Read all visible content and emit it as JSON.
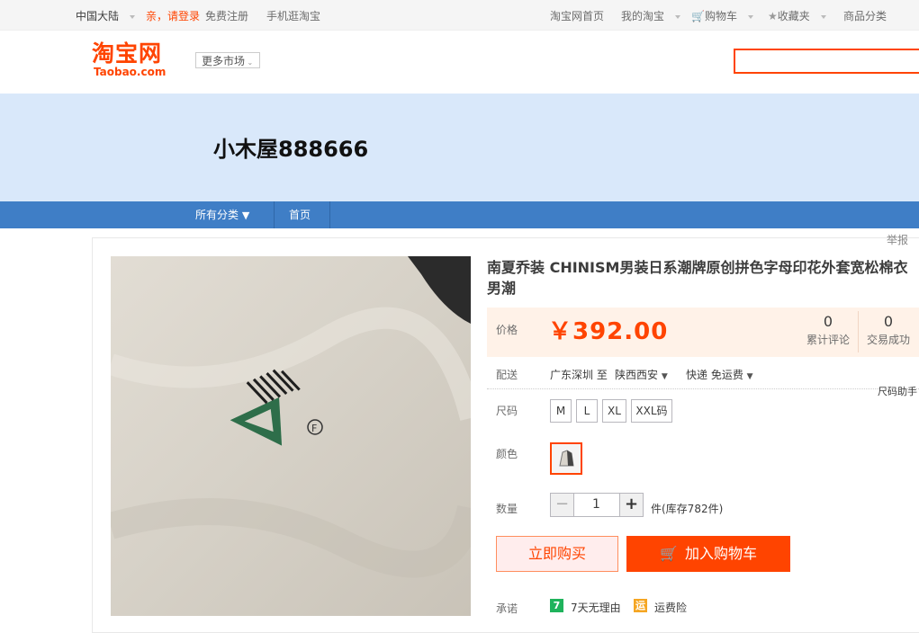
{
  "topbar": {
    "region": "中国大陆",
    "login": "亲，请登录",
    "register": "免费注册",
    "mobile": "手机逛淘宝",
    "home": "淘宝网首页",
    "my_taobao": "我的淘宝",
    "cart": "购物车",
    "favorites": "收藏夹",
    "categories": "商品分类"
  },
  "header": {
    "logo_cn": "淘宝网",
    "logo_en": "Taobao.com",
    "more_markets": "更多市场"
  },
  "shop": {
    "name": "小木屋888666",
    "nav": [
      "所有分类",
      "首页"
    ]
  },
  "report": "举报",
  "product": {
    "title": "南夏乔装 CHINISM男装日系潮牌原创拼色字母印花外套宽松棉衣男潮",
    "price_label": "价格",
    "price": "￥392.00",
    "reviews_count": "0",
    "reviews_label": "累计评论",
    "sales_count": "0",
    "sales_label": "交易成功",
    "delivery_label": "配送",
    "delivery_from": "广东深圳 至",
    "delivery_to": "陕西西安",
    "delivery_method": "快递 免运费",
    "size_helper": "尺码助手",
    "size_label": "尺码",
    "sizes": [
      "M",
      "L",
      "XL",
      "XXL码"
    ],
    "color_label": "颜色",
    "qty_label": "数量",
    "qty_minus": "−",
    "qty_value": "1",
    "qty_plus": "+",
    "stock": "件(库存782件)",
    "buy_now": "立即购买",
    "add_to_cart": "加入购物车",
    "promise_label": "承诺",
    "promise_7day_icon": "7",
    "promise_7day": "7天无理由",
    "promise_insurance_icon": "运",
    "promise_insurance": "运费险"
  },
  "colors": {
    "brand": "#ff4400",
    "shop_banner": "#d9e8fa",
    "shop_nav": "#3f7ec6"
  }
}
